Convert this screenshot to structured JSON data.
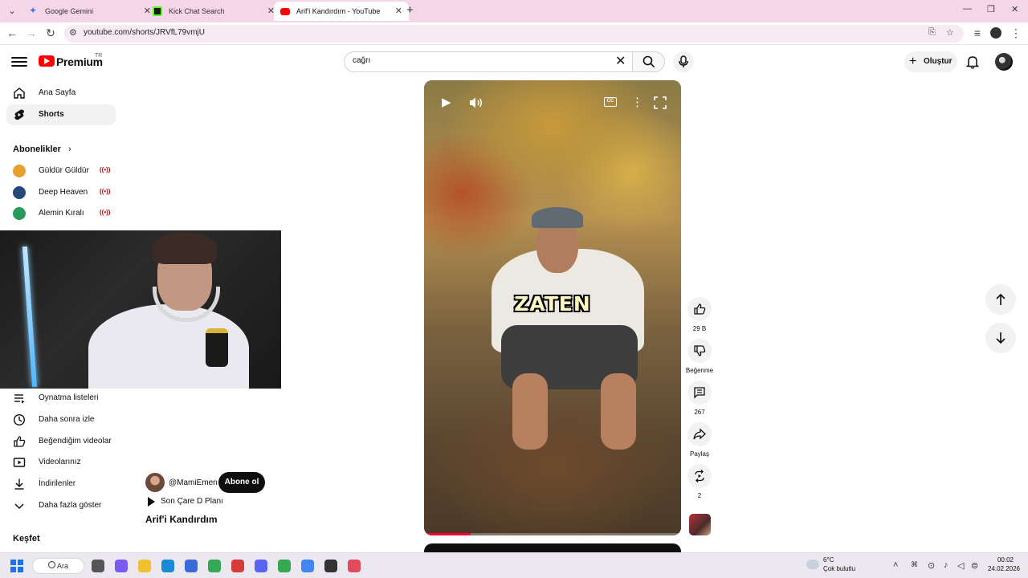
{
  "browser": {
    "tabs": [
      {
        "title": "Google Gemini",
        "favicon_color": "#4a7be8"
      },
      {
        "title": "Kick Chat Search",
        "favicon_color": "#1b1b1b"
      },
      {
        "title": "Arif'i Kandırdım - YouTube",
        "favicon_color": "#ff0000"
      }
    ],
    "active_tab_index": 2,
    "url": "youtube.com/shorts/JRVfL79vmjU",
    "icons": [
      "tab-search-icon",
      "back-icon",
      "forward-icon",
      "reload-icon",
      "site-info-icon",
      "install-icon",
      "bookmark-star-icon",
      "reading-list-icon",
      "profile-icon",
      "kebab-menu-icon"
    ]
  },
  "header": {
    "brand": "Premium",
    "region": "TR",
    "search_value": "cağrı",
    "create_label": "Oluştur"
  },
  "sidebar": {
    "main_items": [
      {
        "label": "Ana Sayfa",
        "icon": "home-icon",
        "active": false
      },
      {
        "label": "Shorts",
        "icon": "shorts-icon",
        "active": true
      }
    ],
    "subscriptions_title": "Abonelikler",
    "subscriptions": [
      {
        "label": "Güldür Güldür",
        "avatar_color": "#e8a030",
        "live": true
      },
      {
        "label": "Deep Heaven",
        "avatar_color": "#234a7a",
        "live": true
      },
      {
        "label": "Alemin Kıralı",
        "avatar_color": "#2a9a5a",
        "live": true
      }
    ],
    "library_items": [
      {
        "label": "Oynatma listeleri",
        "icon": "playlist-icon"
      },
      {
        "label": "Daha sonra izle",
        "icon": "clock-icon"
      },
      {
        "label": "Beğendiğim videolar",
        "icon": "thumb-up-icon"
      },
      {
        "label": "Videolarınız",
        "icon": "video-icon"
      },
      {
        "label": "İndirilenler",
        "icon": "download-icon"
      },
      {
        "label": "Daha fazla göster",
        "icon": "chevron-down-icon"
      }
    ],
    "explore_title": "Keşfet"
  },
  "short": {
    "caption_text": "ZATEN",
    "progress": 0.18,
    "channel": "@MamiEmen",
    "subscribe_label": "Abone ol",
    "music": "Son Çare D Planı",
    "title": "Arif'i Kandırdım"
  },
  "actions": {
    "likes": "29 B",
    "dislike_label": "Beğenme",
    "comments": "267",
    "share_label": "Paylaş",
    "remix_count": "2"
  },
  "taskbar": {
    "search_label": "Ara",
    "temperature": "6°C",
    "weather": "Çok bulutlu",
    "time": "00:02",
    "date": "24.02.2026",
    "apps": [
      {
        "icon": "task-view-icon",
        "color": "#555555"
      },
      {
        "icon": "copilot-icon",
        "color": "#7a5af0"
      },
      {
        "icon": "file-explorer-icon",
        "color": "#f0c030"
      },
      {
        "icon": "edge-icon",
        "color": "#1a8ad8"
      },
      {
        "icon": "store-icon",
        "color": "#3a6ad8"
      },
      {
        "icon": "chrome-icon",
        "color": "#34a853"
      },
      {
        "icon": "letter-l-app-icon",
        "color": "#d83a3a"
      },
      {
        "icon": "discord-icon",
        "color": "#5865f2"
      },
      {
        "icon": "chrome-profile-icon",
        "color": "#34a853"
      },
      {
        "icon": "chrome-profile-2-icon",
        "color": "#4285f4"
      },
      {
        "icon": "obs-icon",
        "color": "#333333"
      },
      {
        "icon": "snipping-tool-icon",
        "color": "#e04a5a"
      }
    ]
  }
}
